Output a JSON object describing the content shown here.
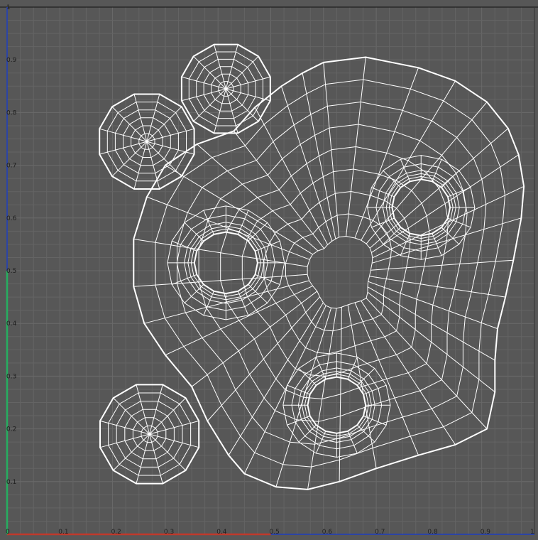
{
  "viewport": {
    "background": "#575757",
    "grid_color": "#646464",
    "u_axis_color": "#c0392b",
    "v_axis_color": "#27ae60",
    "frame_color": "#1f3fbf",
    "border_color": "#111111",
    "wire_color": "#ffffff"
  },
  "u_ticks": [
    "0",
    "0.1",
    "0.2",
    "0.3",
    "0.4",
    "0.5",
    "0.6",
    "0.7",
    "0.8",
    "0.9",
    "1"
  ],
  "v_ticks": [
    "0.1",
    "0.2",
    "0.3",
    "0.4",
    "0.5",
    "0.6",
    "0.7",
    "0.8",
    "0.9",
    "1"
  ],
  "uv_islands": {
    "small_discs": [
      {
        "name": "disc-top",
        "center_uv": [
          0.415,
          0.845
        ],
        "radius_uv": 0.087,
        "rings": 6,
        "segments": 12
      },
      {
        "name": "disc-left",
        "center_uv": [
          0.265,
          0.745
        ],
        "radius_uv": 0.093,
        "rings": 6,
        "segments": 12
      },
      {
        "name": "disc-bottom",
        "center_uv": [
          0.27,
          0.19
        ],
        "radius_uv": 0.097,
        "rings": 6,
        "segments": 12
      }
    ],
    "main_body": {
      "outline_uv": [
        [
          0.68,
          0.905
        ],
        [
          0.6,
          0.895
        ],
        [
          0.56,
          0.875
        ],
        [
          0.52,
          0.85
        ],
        [
          0.47,
          0.81
        ],
        [
          0.43,
          0.765
        ],
        [
          0.36,
          0.74
        ],
        [
          0.3,
          0.7
        ],
        [
          0.265,
          0.64
        ],
        [
          0.24,
          0.56
        ],
        [
          0.24,
          0.47
        ],
        [
          0.26,
          0.4
        ],
        [
          0.3,
          0.34
        ],
        [
          0.35,
          0.28
        ],
        [
          0.38,
          0.215
        ],
        [
          0.42,
          0.15
        ],
        [
          0.45,
          0.115
        ],
        [
          0.51,
          0.09
        ],
        [
          0.57,
          0.085
        ],
        [
          0.63,
          0.1
        ],
        [
          0.7,
          0.125
        ],
        [
          0.78,
          0.15
        ],
        [
          0.85,
          0.17
        ],
        [
          0.91,
          0.2
        ],
        [
          0.925,
          0.27
        ],
        [
          0.925,
          0.33
        ],
        [
          0.93,
          0.39
        ],
        [
          0.945,
          0.45
        ],
        [
          0.96,
          0.52
        ],
        [
          0.975,
          0.6
        ],
        [
          0.98,
          0.66
        ],
        [
          0.97,
          0.72
        ],
        [
          0.95,
          0.77
        ],
        [
          0.91,
          0.82
        ],
        [
          0.85,
          0.86
        ],
        [
          0.78,
          0.885
        ]
      ],
      "holes": [
        {
          "name": "hole-left",
          "center_uv": [
            0.415,
            0.515
          ],
          "radius_uv": 0.06
        },
        {
          "name": "hole-right",
          "center_uv": [
            0.785,
            0.62
          ],
          "radius_uv": 0.055
        },
        {
          "name": "hole-bottom",
          "center_uv": [
            0.625,
            0.245
          ],
          "radius_uv": 0.055
        }
      ],
      "edge_loops": 8,
      "radial_segments": 36
    }
  }
}
